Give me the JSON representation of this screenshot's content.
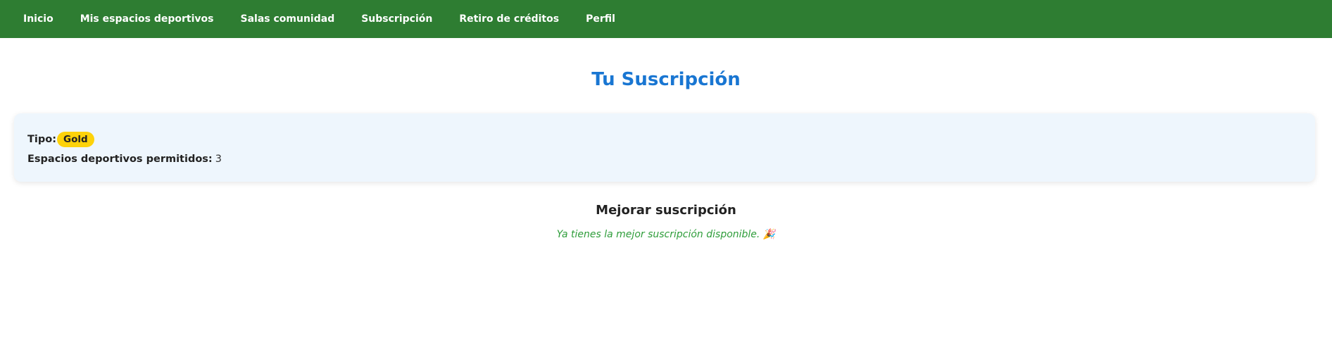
{
  "nav": {
    "items": [
      {
        "label": "Inicio"
      },
      {
        "label": "Mis espacios deportivos"
      },
      {
        "label": "Salas comunidad"
      },
      {
        "label": "Subscripción"
      },
      {
        "label": "Retiro de créditos"
      },
      {
        "label": "Perfil"
      }
    ]
  },
  "page": {
    "title": "Tu Suscripción"
  },
  "subscription": {
    "type_label": "Tipo:",
    "type_value": "Gold",
    "spaces_label": "Espacios deportivos permitidos:",
    "spaces_value": "3"
  },
  "upgrade": {
    "title": "Mejorar suscripción",
    "message": "Ya tienes la mejor suscripción disponible. 🎉"
  },
  "colors": {
    "navbar": "#2e7d32",
    "title": "#1976d2",
    "badge": "#fdd20a",
    "card": "#eef6fd",
    "success_text": "#2e9d3a"
  }
}
